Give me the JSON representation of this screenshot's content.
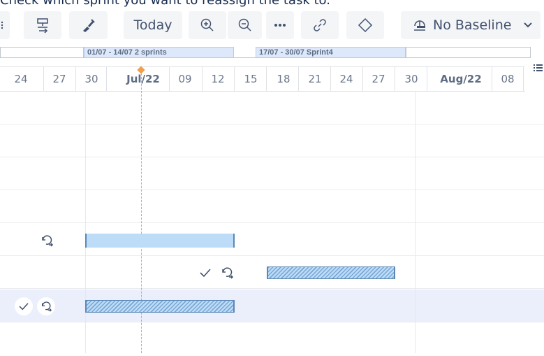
{
  "instruction": "Check which sprint you want to reassign the task to.",
  "toolbar": {
    "today_label": "Today",
    "baseline_label": "No Baseline"
  },
  "sprints": [
    {
      "label": "01/07 - 14/07 2 sprints"
    },
    {
      "label": "17/07 - 30/07 Sprint4"
    }
  ],
  "timeline": {
    "ticks": [
      "24",
      "27",
      "30",
      "Jul/22",
      "09",
      "12",
      "15",
      "18",
      "21",
      "24",
      "27",
      "30",
      "Aug/22",
      "08"
    ]
  },
  "colors": {
    "today_line": "#f0a04b",
    "bar_fill": "#bcdcf7",
    "bar_border": "#5b87b6",
    "selected_row": "#eaeffb"
  }
}
